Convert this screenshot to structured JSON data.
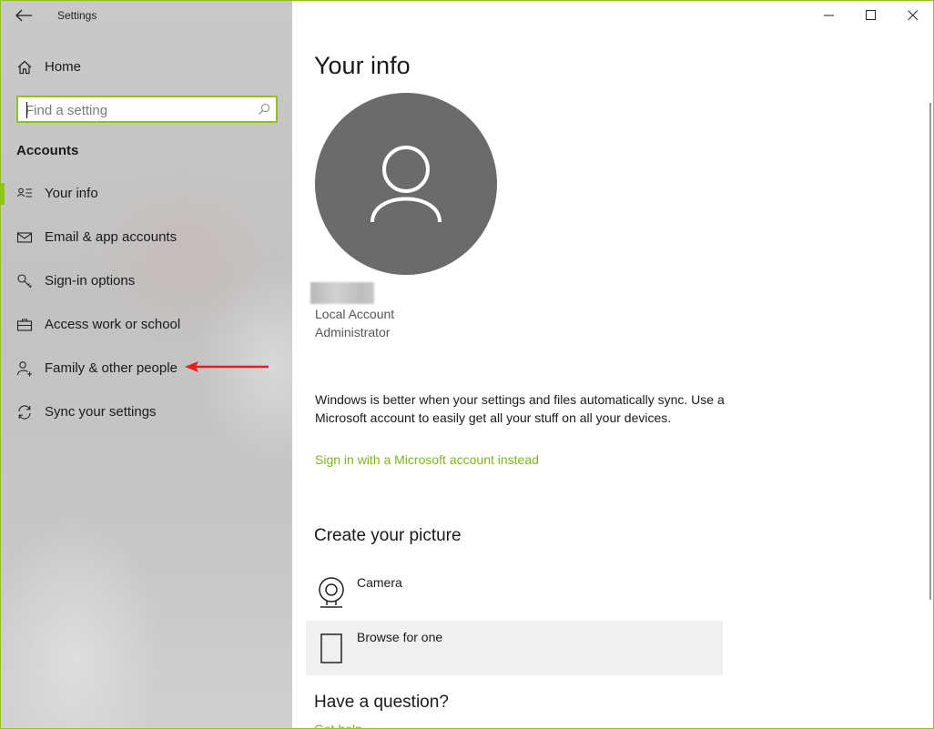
{
  "window": {
    "app_title": "Settings",
    "accent_color": "#8fc31f",
    "link_color": "#7eb51c"
  },
  "sidebar": {
    "home_label": "Home",
    "search": {
      "placeholder": "Find a setting",
      "value": ""
    },
    "section_title": "Accounts",
    "items": [
      {
        "label": "Your info",
        "icon": "contact-card-icon",
        "active": true
      },
      {
        "label": "Email & app accounts",
        "icon": "mail-icon",
        "active": false
      },
      {
        "label": "Sign-in options",
        "icon": "key-icon",
        "active": false
      },
      {
        "label": "Access work or school",
        "icon": "briefcase-icon",
        "active": false
      },
      {
        "label": "Family & other people",
        "icon": "add-person-icon",
        "active": false
      },
      {
        "label": "Sync your settings",
        "icon": "sync-icon",
        "active": false
      }
    ]
  },
  "main": {
    "title": "Your info",
    "account_type": "Local Account",
    "account_role": "Administrator",
    "sync_message": "Windows is better when your settings and files automatically sync. Use a Microsoft account to easily get all your stuff on all your devices.",
    "ms_account_link": "Sign in with a Microsoft account instead",
    "create_picture_heading": "Create your picture",
    "picture_options": [
      {
        "label": "Camera",
        "icon": "camera-icon"
      },
      {
        "label": "Browse for one",
        "icon": "browse-file-icon"
      }
    ],
    "question_heading": "Have a question?",
    "help_link": "Get help"
  }
}
